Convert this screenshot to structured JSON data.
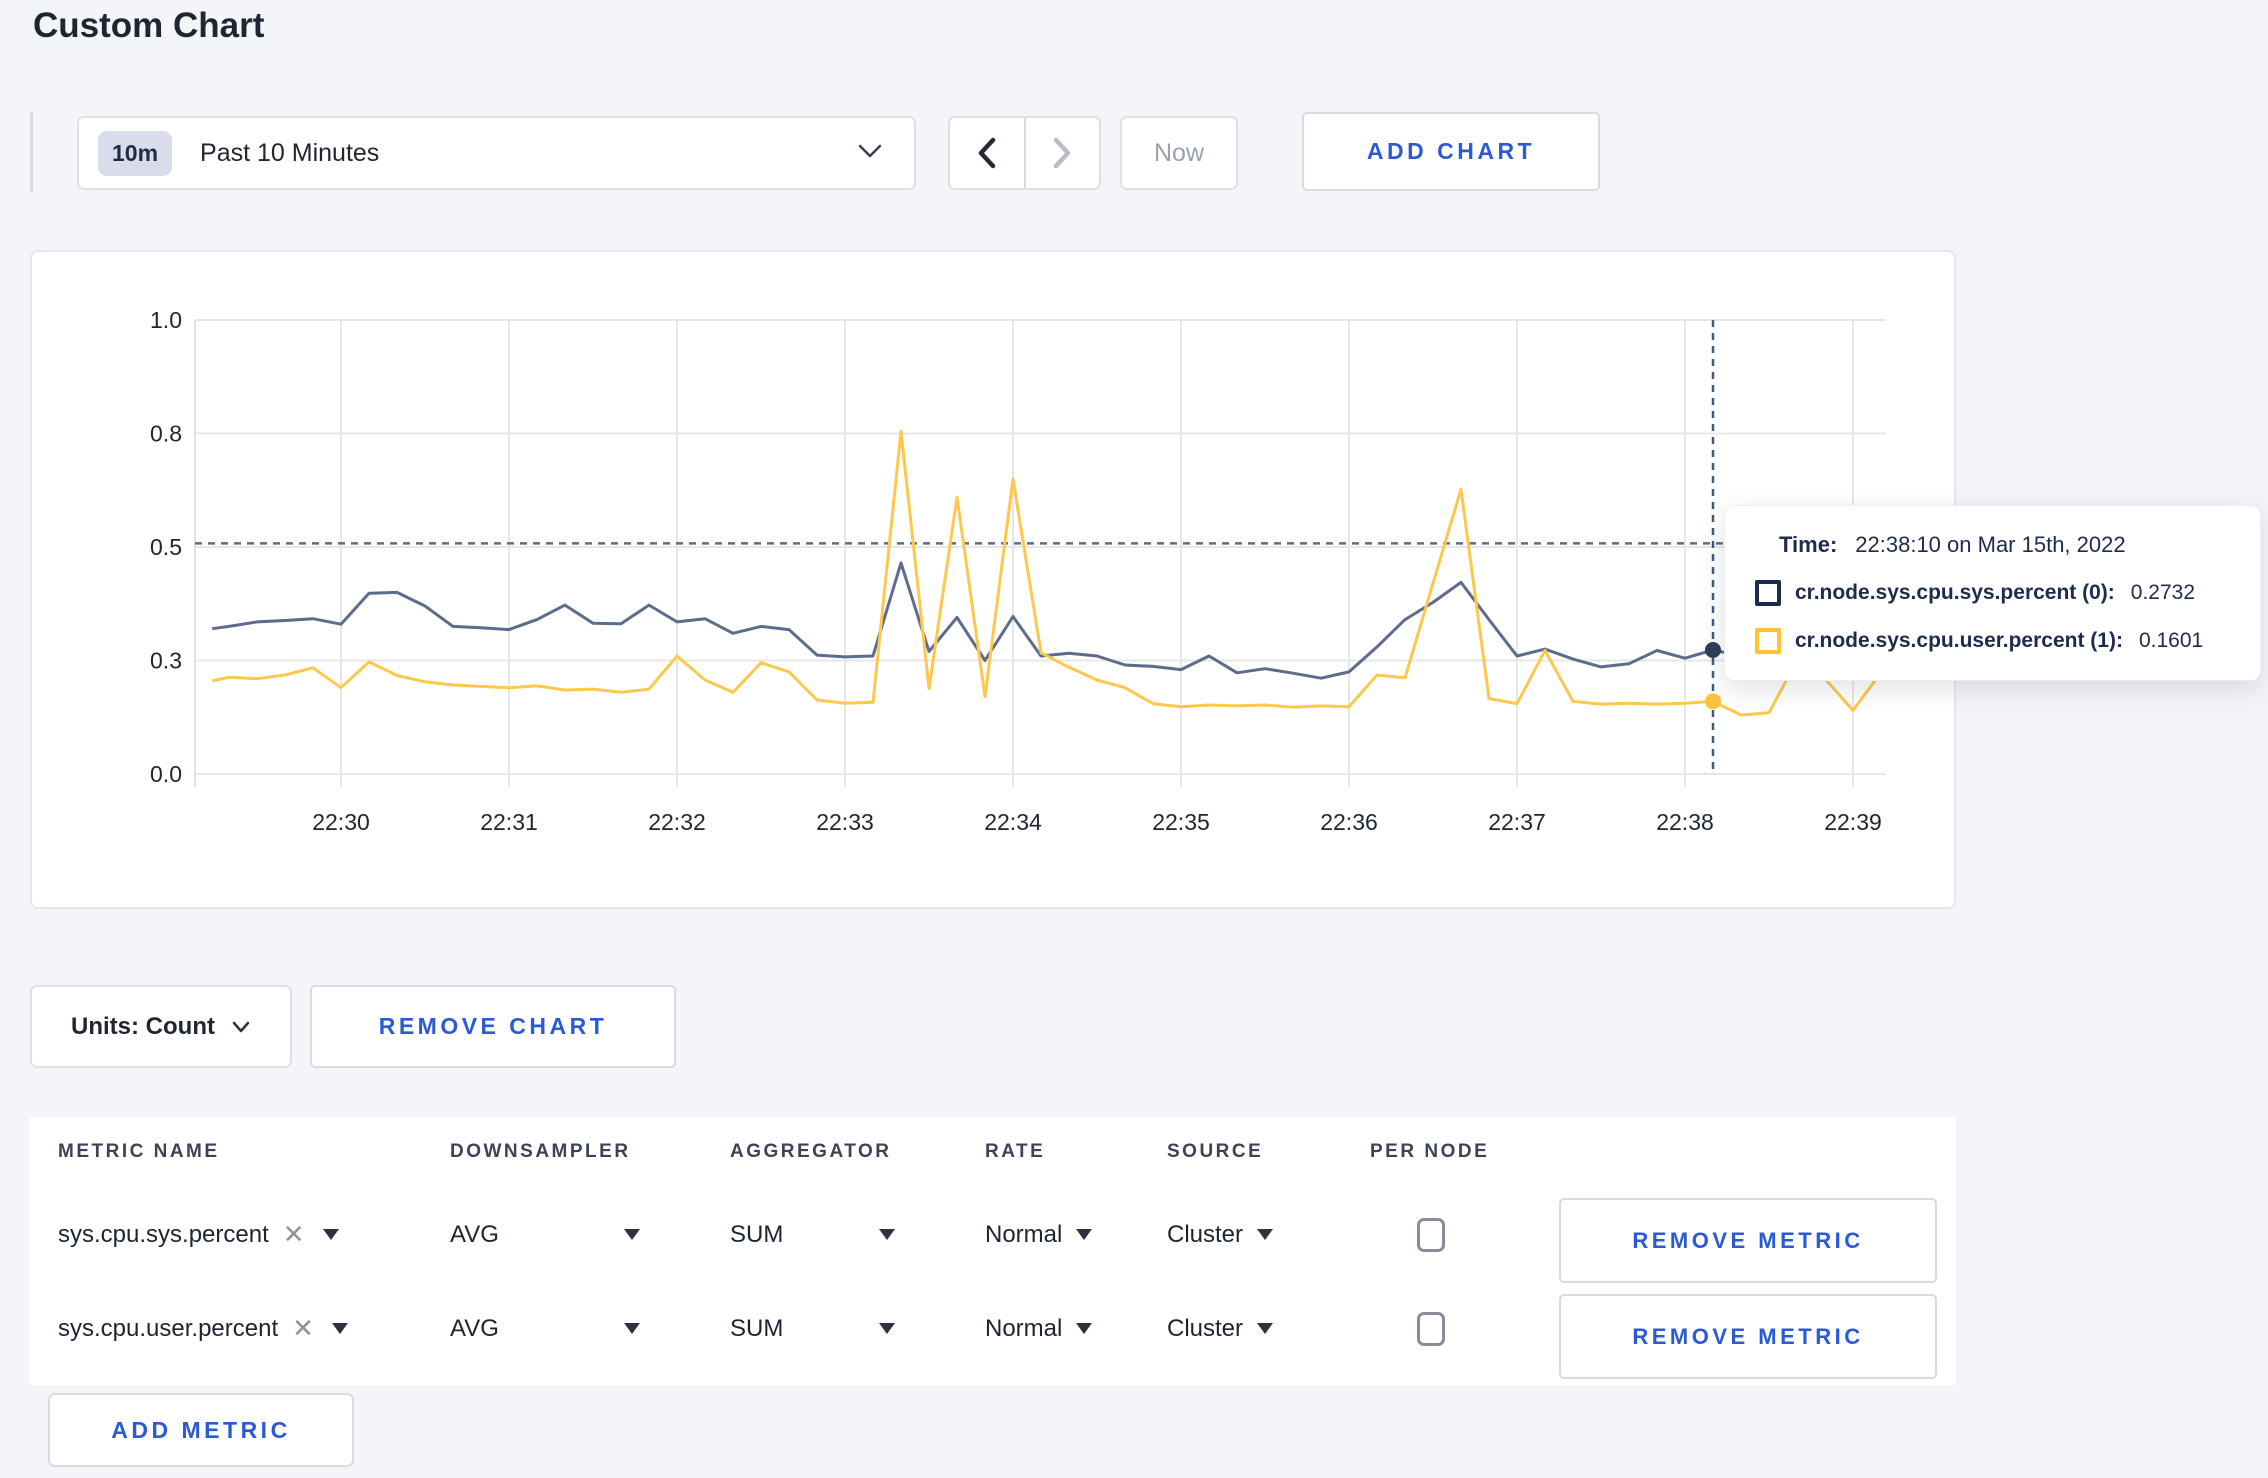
{
  "page": {
    "title": "Custom Chart"
  },
  "toolbar": {
    "time_range": {
      "badge": "10m",
      "label": "Past 10 Minutes"
    },
    "now_label": "Now",
    "add_chart_label": "ADD CHART"
  },
  "chart_data": {
    "type": "line",
    "title": "",
    "xlabel": "",
    "ylabel": "",
    "ylim": [
      0,
      1
    ],
    "grid": true,
    "x_axis": {
      "tick_labels": [
        "22:30",
        "22:31",
        "22:32",
        "22:33",
        "22:34",
        "22:35",
        "22:36",
        "22:37",
        "22:38",
        "22:39"
      ],
      "tick_seconds": [
        60,
        120,
        180,
        240,
        300,
        360,
        420,
        480,
        540,
        600
      ],
      "note": "seconds measured from 22:29:00, data window approx 22:29:14 to 22:39:12"
    },
    "y_axis": {
      "tick_labels": [
        "0.0",
        "0.3",
        "0.5",
        "0.8",
        "1.0"
      ],
      "tick_values": [
        0,
        0.25,
        0.5,
        0.75,
        1.0
      ]
    },
    "threshold_dashed_line": 0.508,
    "crosshair": {
      "time_sec": 550,
      "time_label": "22:38:10"
    },
    "series": [
      {
        "name": "cr.node.sys.cpu.sys.percent (0)",
        "color": "#5b6c8c",
        "points": [
          [
            14,
            0.32
          ],
          [
            20,
            0.325
          ],
          [
            30,
            0.335
          ],
          [
            40,
            0.338
          ],
          [
            50,
            0.342
          ],
          [
            60,
            0.33
          ],
          [
            70,
            0.398
          ],
          [
            80,
            0.4
          ],
          [
            90,
            0.37
          ],
          [
            100,
            0.325
          ],
          [
            110,
            0.322
          ],
          [
            120,
            0.318
          ],
          [
            130,
            0.34
          ],
          [
            140,
            0.372
          ],
          [
            150,
            0.332
          ],
          [
            160,
            0.331
          ],
          [
            170,
            0.372
          ],
          [
            180,
            0.335
          ],
          [
            190,
            0.342
          ],
          [
            200,
            0.31
          ],
          [
            210,
            0.325
          ],
          [
            220,
            0.318
          ],
          [
            230,
            0.262
          ],
          [
            240,
            0.258
          ],
          [
            250,
            0.26
          ],
          [
            260,
            0.465
          ],
          [
            270,
            0.27
          ],
          [
            280,
            0.345
          ],
          [
            290,
            0.25
          ],
          [
            300,
            0.347
          ],
          [
            310,
            0.26
          ],
          [
            320,
            0.266
          ],
          [
            330,
            0.26
          ],
          [
            340,
            0.24
          ],
          [
            350,
            0.237
          ],
          [
            360,
            0.23
          ],
          [
            370,
            0.26
          ],
          [
            380,
            0.223
          ],
          [
            390,
            0.232
          ],
          [
            400,
            0.222
          ],
          [
            410,
            0.211
          ],
          [
            420,
            0.225
          ],
          [
            430,
            0.28
          ],
          [
            440,
            0.34
          ],
          [
            450,
            0.378
          ],
          [
            460,
            0.422
          ],
          [
            470,
            0.34
          ],
          [
            480,
            0.26
          ],
          [
            490,
            0.275
          ],
          [
            500,
            0.253
          ],
          [
            510,
            0.236
          ],
          [
            520,
            0.243
          ],
          [
            530,
            0.272
          ],
          [
            540,
            0.255
          ],
          [
            550,
            0.2732
          ],
          [
            560,
            0.26
          ],
          [
            570,
            0.275
          ],
          [
            580,
            0.3
          ],
          [
            590,
            0.3
          ],
          [
            600,
            0.295
          ],
          [
            612,
            0.3
          ]
        ]
      },
      {
        "name": "cr.node.sys.cpu.user.percent (1)",
        "color": "#fdc84b",
        "points": [
          [
            14,
            0.205
          ],
          [
            20,
            0.213
          ],
          [
            30,
            0.21
          ],
          [
            40,
            0.218
          ],
          [
            50,
            0.234
          ],
          [
            60,
            0.19
          ],
          [
            70,
            0.247
          ],
          [
            80,
            0.217
          ],
          [
            90,
            0.203
          ],
          [
            100,
            0.196
          ],
          [
            110,
            0.193
          ],
          [
            120,
            0.19
          ],
          [
            130,
            0.194
          ],
          [
            140,
            0.185
          ],
          [
            150,
            0.187
          ],
          [
            160,
            0.18
          ],
          [
            170,
            0.187
          ],
          [
            180,
            0.26
          ],
          [
            190,
            0.207
          ],
          [
            200,
            0.18
          ],
          [
            210,
            0.245
          ],
          [
            220,
            0.225
          ],
          [
            230,
            0.163
          ],
          [
            240,
            0.156
          ],
          [
            250,
            0.158
          ],
          [
            260,
            0.755
          ],
          [
            270,
            0.188
          ],
          [
            280,
            0.61
          ],
          [
            290,
            0.17
          ],
          [
            300,
            0.65
          ],
          [
            310,
            0.267
          ],
          [
            320,
            0.235
          ],
          [
            330,
            0.207
          ],
          [
            340,
            0.19
          ],
          [
            350,
            0.155
          ],
          [
            360,
            0.148
          ],
          [
            370,
            0.152
          ],
          [
            380,
            0.15
          ],
          [
            390,
            0.152
          ],
          [
            400,
            0.147
          ],
          [
            410,
            0.15
          ],
          [
            420,
            0.148
          ],
          [
            430,
            0.218
          ],
          [
            440,
            0.212
          ],
          [
            450,
            0.42
          ],
          [
            460,
            0.627
          ],
          [
            470,
            0.166
          ],
          [
            480,
            0.155
          ],
          [
            490,
            0.272
          ],
          [
            500,
            0.16
          ],
          [
            510,
            0.154
          ],
          [
            520,
            0.156
          ],
          [
            530,
            0.154
          ],
          [
            540,
            0.156
          ],
          [
            550,
            0.1601
          ],
          [
            560,
            0.13
          ],
          [
            570,
            0.135
          ],
          [
            580,
            0.25
          ],
          [
            590,
            0.21
          ],
          [
            600,
            0.14
          ],
          [
            612,
            0.24
          ]
        ]
      }
    ],
    "hover_values": [
      0.2732,
      0.1601
    ]
  },
  "tooltip": {
    "time_label": "Time:",
    "time_value": "22:38:10 on Mar 15th, 2022",
    "rows": [
      {
        "label": "cr.node.sys.cpu.sys.percent (0):",
        "value": "0.2732",
        "color": "#1d2b4d"
      },
      {
        "label": "cr.node.sys.cpu.user.percent (1):",
        "value": "0.1601",
        "color": "#fdc330"
      }
    ]
  },
  "chart_footer": {
    "units_label": "Units: Count",
    "remove_chart_label": "REMOVE CHART"
  },
  "metrics_table": {
    "headers": [
      "METRIC NAME",
      "DOWNSAMPLER",
      "AGGREGATOR",
      "RATE",
      "SOURCE",
      "PER NODE"
    ],
    "rows": [
      {
        "metric": "sys.cpu.sys.percent",
        "downsampler": "AVG",
        "aggregator": "SUM",
        "rate": "Normal",
        "source": "Cluster",
        "per_node_checked": false,
        "remove_label": "REMOVE METRIC"
      },
      {
        "metric": "sys.cpu.user.percent",
        "downsampler": "AVG",
        "aggregator": "SUM",
        "rate": "Normal",
        "source": "Cluster",
        "per_node_checked": false,
        "remove_label": "REMOVE METRIC"
      }
    ],
    "add_metric_label": "ADD METRIC"
  },
  "colors": {
    "accent_blue": "#2a5ad6",
    "series_sys": "#5b6c8c",
    "series_user": "#fdc84b",
    "threshold_dash": "#567089",
    "crosshair_dash": "#3d5d7c",
    "gridline": "#e7e7e7"
  }
}
